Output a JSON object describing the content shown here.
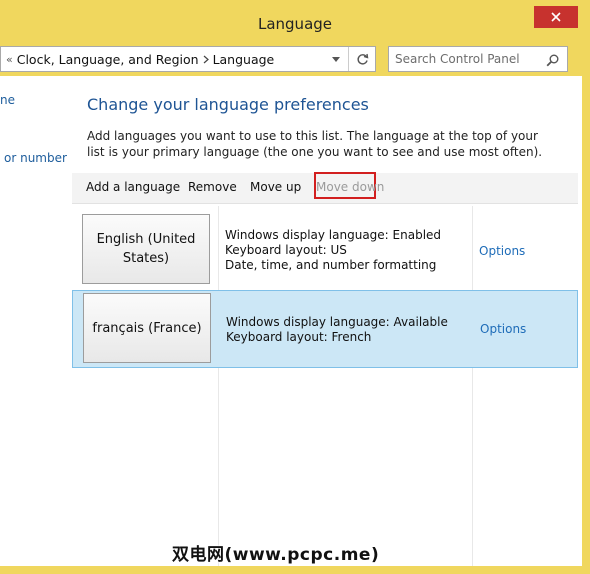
{
  "window": {
    "title": "Language",
    "accent_color": "#f0d75e",
    "close_color": "#c7322e"
  },
  "address": {
    "overflow_chevron": "«",
    "crumbs": [
      "Clock, Language, and Region",
      "Language"
    ]
  },
  "search": {
    "placeholder": "Search Control Panel"
  },
  "sidebar": {
    "items": [
      "ne",
      "or number"
    ]
  },
  "main": {
    "heading": "Change your language preferences",
    "description": "Add languages you want to use to this list. The language at the top of your list is your primary language (the one you want to see and use most often)."
  },
  "toolbar": {
    "add_language": "Add a language",
    "remove": "Remove",
    "move_up": "Move up",
    "move_down": "Move down",
    "highlight_color": "#d21f1f"
  },
  "languages": [
    {
      "name": "English (United States)",
      "info": [
        "Windows display language: Enabled",
        "Keyboard layout: US",
        "Date, time, and number formatting"
      ],
      "options": "Options",
      "selected": false
    },
    {
      "name": "français (France)",
      "info": [
        "Windows display language: Available",
        "Keyboard layout: French"
      ],
      "options": "Options",
      "selected": true
    }
  ],
  "watermark": "双电网(www.pcpc.me)"
}
